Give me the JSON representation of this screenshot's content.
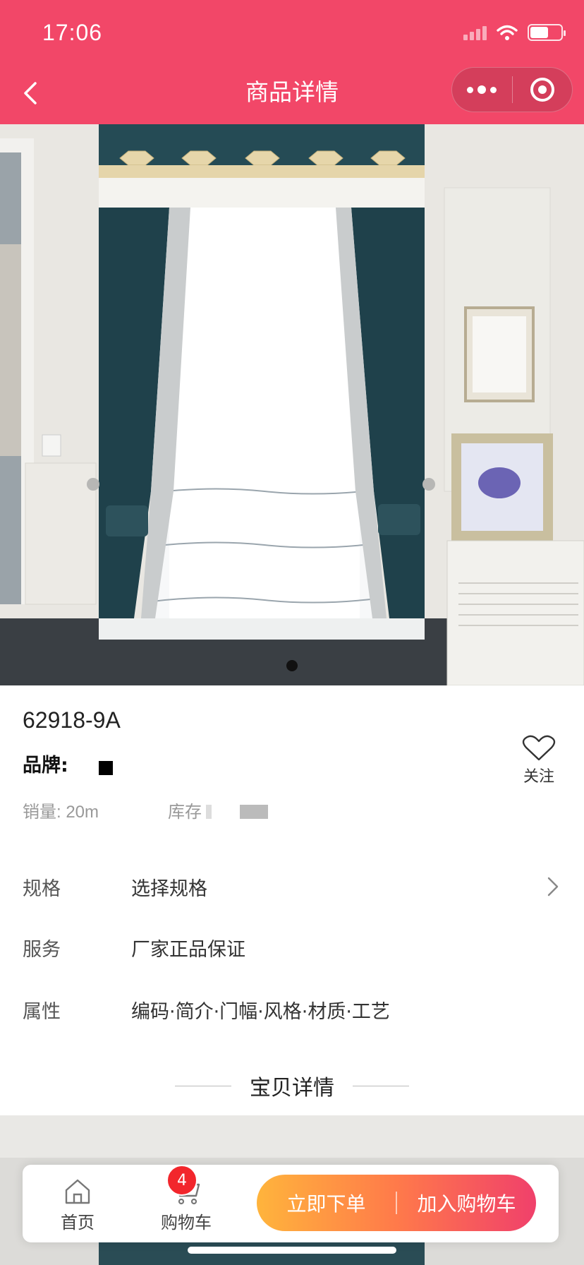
{
  "status_bar": {
    "time": "17:06"
  },
  "header": {
    "title": "商品详情"
  },
  "product": {
    "sku": "62918-9A",
    "brand_label": "品牌:",
    "favorite_label": "关注",
    "sales": "销量: 20m",
    "stock_label": "库存"
  },
  "rows": [
    {
      "key": "规格",
      "value": "选择规格"
    },
    {
      "key": "服务",
      "value": "厂家正品保证"
    },
    {
      "key": "属性",
      "value": "编码·简介·门幅·风格·材质·工艺"
    }
  ],
  "detail_section": {
    "title": "宝贝详情"
  },
  "tabbar": {
    "home_label": "首页",
    "cart_label": "购物车",
    "cart_count": "4",
    "buy_now_label": "立即下单",
    "add_to_cart_label": "加入购物车"
  },
  "colors": {
    "header_bg": "#f24768",
    "badge": "#f2262c",
    "cta_start": "#ffb43c",
    "cta_end": "#f0406b"
  }
}
